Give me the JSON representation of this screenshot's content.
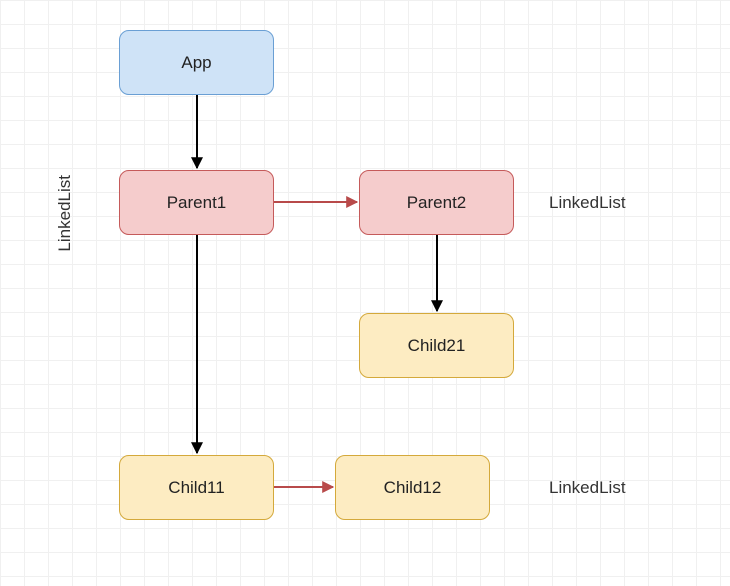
{
  "nodes": {
    "app": {
      "label": "App"
    },
    "parent1": {
      "label": "Parent1"
    },
    "parent2": {
      "label": "Parent2"
    },
    "child21": {
      "label": "Child21"
    },
    "child11": {
      "label": "Child11"
    },
    "child12": {
      "label": "Child12"
    }
  },
  "labels": {
    "left": "LinkedList",
    "right1": "LinkedList",
    "right2": "LinkedList"
  },
  "colors": {
    "blue_bg": "#cfe3f7",
    "blue_border": "#6a9fd4",
    "pink_bg": "#f5cccc",
    "pink_border": "#c55a5a",
    "yellow_bg": "#fdecc2",
    "yellow_border": "#d4a93b",
    "arrow_black": "#000000",
    "arrow_red": "#b84a4a"
  }
}
